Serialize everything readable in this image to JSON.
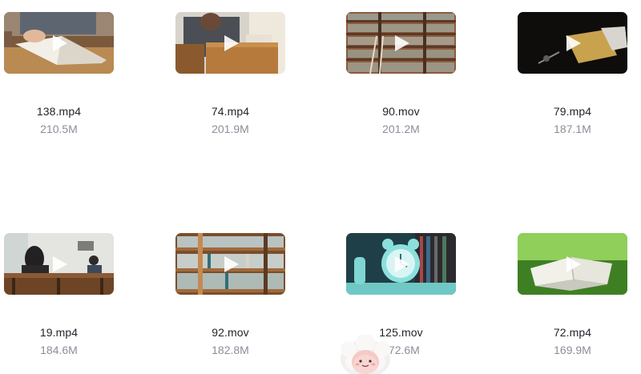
{
  "videos": [
    {
      "name": "138.mp4",
      "size": "210.5M",
      "thumb_icon": "person-reading-book-thumbnail"
    },
    {
      "name": "74.mp4",
      "size": "201.9M",
      "thumb_icon": "person-at-desk-thumbnail"
    },
    {
      "name": "90.mov",
      "size": "201.2M",
      "thumb_icon": "library-bookshelf-thumbnail"
    },
    {
      "name": "79.mp4",
      "size": "187.1M",
      "thumb_icon": "dark-desk-paper-thumbnail"
    },
    {
      "name": "19.mp4",
      "size": "184.6M",
      "thumb_icon": "classroom-thumbnail"
    },
    {
      "name": "92.mov",
      "size": "182.8M",
      "thumb_icon": "bookshelf-thumbnail"
    },
    {
      "name": "125.mov",
      "size": "172.6M",
      "thumb_icon": "alarm-clock-thumbnail"
    },
    {
      "name": "72.mp4",
      "size": "169.9M",
      "thumb_icon": "book-on-grass-thumbnail"
    }
  ],
  "overlay": {
    "icon": "mascot-assistant-icon"
  },
  "colors": {
    "filename": "#1f2329",
    "filesize": "#8a8f99",
    "play_icon": "#ffffff"
  }
}
